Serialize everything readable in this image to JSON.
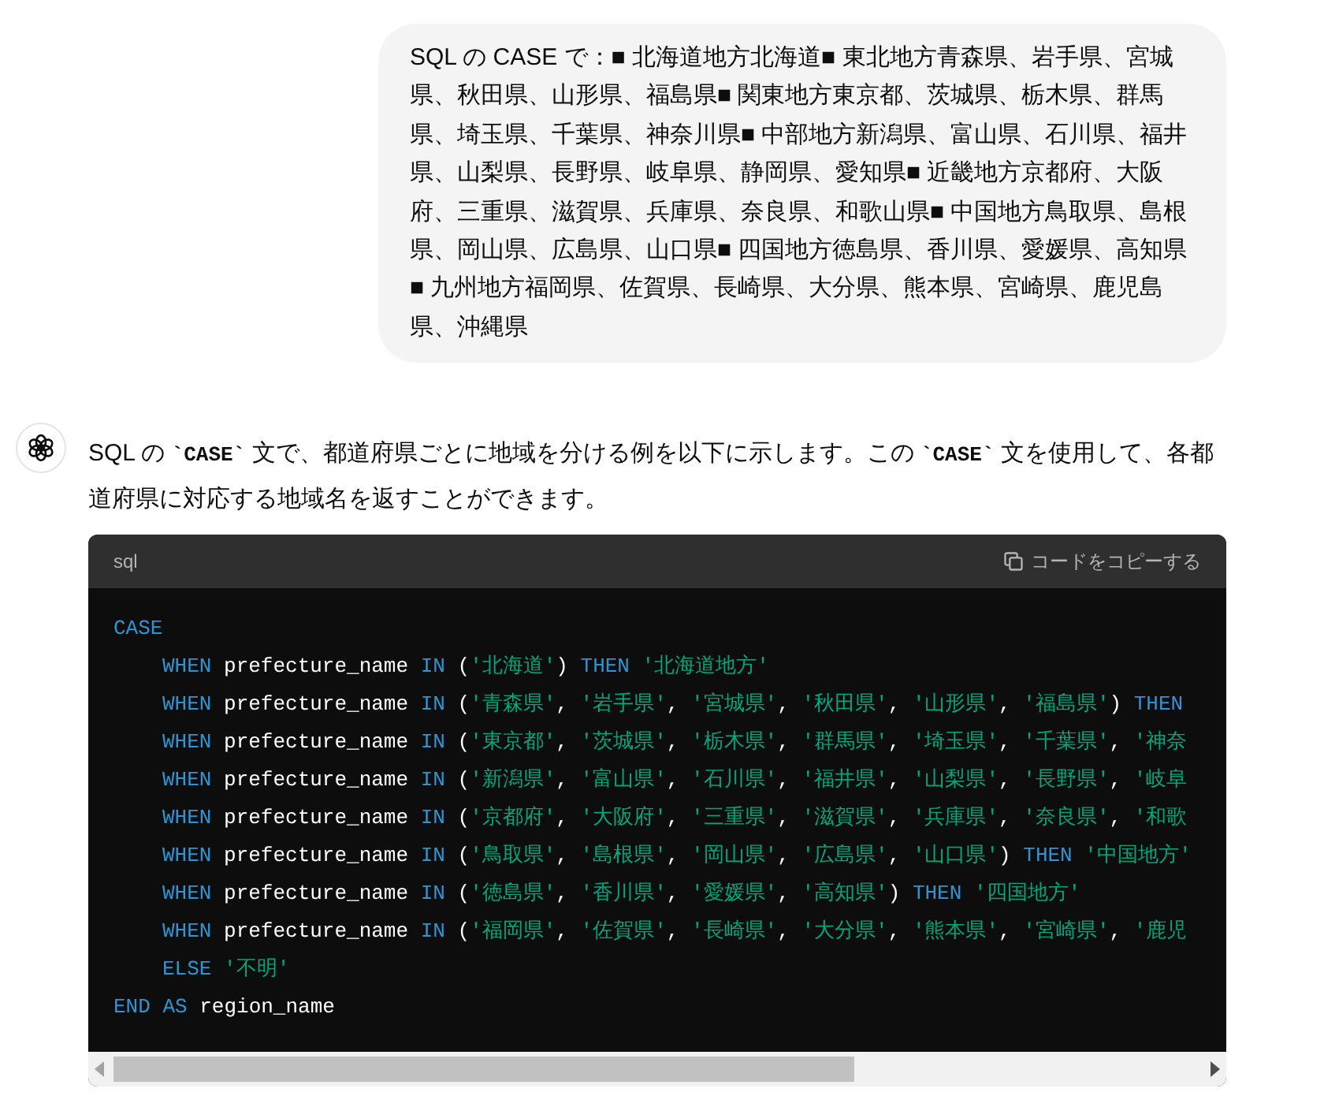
{
  "user_message": {
    "text": "SQL の CASE で：■ 北海道地方北海道■ 東北地方青森県、岩手県、宮城県、秋田県、山形県、福島県■ 関東地方東京都、茨城県、栃木県、群馬県、埼玉県、千葉県、神奈川県■ 中部地方新潟県、富山県、石川県、福井県、山梨県、長野県、岐阜県、静岡県、愛知県■ 近畿地方京都府、大阪府、三重県、滋賀県、兵庫県、奈良県、和歌山県■ 中国地方鳥取県、島根県、岡山県、広島県、山口県■ 四国地方徳島県、香川県、愛媛県、高知県■ 九州地方福岡県、佐賀県、長崎県、大分県、熊本県、宮崎県、鹿児島県、沖縄県"
  },
  "assistant_message": {
    "paragraph": [
      {
        "kind": "text",
        "text": "SQL の "
      },
      {
        "kind": "code",
        "text": "`CASE`"
      },
      {
        "kind": "text",
        "text": " 文で、都道府県ごとに地域を分ける例を以下に示します。この "
      },
      {
        "kind": "code",
        "text": "`CASE`"
      },
      {
        "kind": "text",
        "text": " 文を使用して、各都道府県に対応する地域名を返すことができます。"
      }
    ],
    "code_block": {
      "language": "sql",
      "copy_label": "コードをコピーする",
      "lines": [
        {
          "tokens": [
            {
              "kind": "keyword",
              "text": "CASE"
            }
          ],
          "children": [
            {
              "tokens": [
                {
                  "kind": "keyword",
                  "text": "WHEN"
                },
                {
                  "kind": "plain",
                  "text": " prefecture_name "
                },
                {
                  "kind": "keyword",
                  "text": "IN"
                },
                {
                  "kind": "plain",
                  "text": " ("
                },
                {
                  "kind": "string",
                  "text": "'北海道'"
                },
                {
                  "kind": "plain",
                  "text": ") "
                },
                {
                  "kind": "keyword",
                  "text": "THEN"
                },
                {
                  "kind": "string",
                  "text": " '北海道地方'"
                }
              ]
            },
            {
              "tokens": [
                {
                  "kind": "keyword",
                  "text": "WHEN"
                },
                {
                  "kind": "plain",
                  "text": " prefecture_name "
                },
                {
                  "kind": "keyword",
                  "text": "IN"
                },
                {
                  "kind": "plain",
                  "text": " ("
                },
                {
                  "kind": "string",
                  "text": "'青森県'"
                },
                {
                  "kind": "plain",
                  "text": ", "
                },
                {
                  "kind": "string",
                  "text": "'岩手県'"
                },
                {
                  "kind": "plain",
                  "text": ", "
                },
                {
                  "kind": "string",
                  "text": "'宮城県'"
                },
                {
                  "kind": "plain",
                  "text": ", "
                },
                {
                  "kind": "string",
                  "text": "'秋田県'"
                },
                {
                  "kind": "plain",
                  "text": ", "
                },
                {
                  "kind": "string",
                  "text": "'山形県'"
                },
                {
                  "kind": "plain",
                  "text": ", "
                },
                {
                  "kind": "string",
                  "text": "'福島県'"
                },
                {
                  "kind": "plain",
                  "text": ") "
                },
                {
                  "kind": "keyword",
                  "text": "THEN"
                }
              ]
            },
            {
              "tokens": [
                {
                  "kind": "keyword",
                  "text": "WHEN"
                },
                {
                  "kind": "plain",
                  "text": " prefecture_name "
                },
                {
                  "kind": "keyword",
                  "text": "IN"
                },
                {
                  "kind": "plain",
                  "text": " ("
                },
                {
                  "kind": "string",
                  "text": "'東京都'"
                },
                {
                  "kind": "plain",
                  "text": ", "
                },
                {
                  "kind": "string",
                  "text": "'茨城県'"
                },
                {
                  "kind": "plain",
                  "text": ", "
                },
                {
                  "kind": "string",
                  "text": "'栃木県'"
                },
                {
                  "kind": "plain",
                  "text": ", "
                },
                {
                  "kind": "string",
                  "text": "'群馬県'"
                },
                {
                  "kind": "plain",
                  "text": ", "
                },
                {
                  "kind": "string",
                  "text": "'埼玉県'"
                },
                {
                  "kind": "plain",
                  "text": ", "
                },
                {
                  "kind": "string",
                  "text": "'千葉県'"
                },
                {
                  "kind": "plain",
                  "text": ", "
                },
                {
                  "kind": "string",
                  "text": "'神奈"
                }
              ]
            },
            {
              "tokens": [
                {
                  "kind": "keyword",
                  "text": "WHEN"
                },
                {
                  "kind": "plain",
                  "text": " prefecture_name "
                },
                {
                  "kind": "keyword",
                  "text": "IN"
                },
                {
                  "kind": "plain",
                  "text": " ("
                },
                {
                  "kind": "string",
                  "text": "'新潟県'"
                },
                {
                  "kind": "plain",
                  "text": ", "
                },
                {
                  "kind": "string",
                  "text": "'富山県'"
                },
                {
                  "kind": "plain",
                  "text": ", "
                },
                {
                  "kind": "string",
                  "text": "'石川県'"
                },
                {
                  "kind": "plain",
                  "text": ", "
                },
                {
                  "kind": "string",
                  "text": "'福井県'"
                },
                {
                  "kind": "plain",
                  "text": ", "
                },
                {
                  "kind": "string",
                  "text": "'山梨県'"
                },
                {
                  "kind": "plain",
                  "text": ", "
                },
                {
                  "kind": "string",
                  "text": "'長野県'"
                },
                {
                  "kind": "plain",
                  "text": ", "
                },
                {
                  "kind": "string",
                  "text": "'岐阜"
                }
              ]
            },
            {
              "tokens": [
                {
                  "kind": "keyword",
                  "text": "WHEN"
                },
                {
                  "kind": "plain",
                  "text": " prefecture_name "
                },
                {
                  "kind": "keyword",
                  "text": "IN"
                },
                {
                  "kind": "plain",
                  "text": " ("
                },
                {
                  "kind": "string",
                  "text": "'京都府'"
                },
                {
                  "kind": "plain",
                  "text": ", "
                },
                {
                  "kind": "string",
                  "text": "'大阪府'"
                },
                {
                  "kind": "plain",
                  "text": ", "
                },
                {
                  "kind": "string",
                  "text": "'三重県'"
                },
                {
                  "kind": "plain",
                  "text": ", "
                },
                {
                  "kind": "string",
                  "text": "'滋賀県'"
                },
                {
                  "kind": "plain",
                  "text": ", "
                },
                {
                  "kind": "string",
                  "text": "'兵庫県'"
                },
                {
                  "kind": "plain",
                  "text": ", "
                },
                {
                  "kind": "string",
                  "text": "'奈良県'"
                },
                {
                  "kind": "plain",
                  "text": ", "
                },
                {
                  "kind": "string",
                  "text": "'和歌"
                }
              ]
            },
            {
              "tokens": [
                {
                  "kind": "keyword",
                  "text": "WHEN"
                },
                {
                  "kind": "plain",
                  "text": " prefecture_name "
                },
                {
                  "kind": "keyword",
                  "text": "IN"
                },
                {
                  "kind": "plain",
                  "text": " ("
                },
                {
                  "kind": "string",
                  "text": "'鳥取県'"
                },
                {
                  "kind": "plain",
                  "text": ", "
                },
                {
                  "kind": "string",
                  "text": "'島根県'"
                },
                {
                  "kind": "plain",
                  "text": ", "
                },
                {
                  "kind": "string",
                  "text": "'岡山県'"
                },
                {
                  "kind": "plain",
                  "text": ", "
                },
                {
                  "kind": "string",
                  "text": "'広島県'"
                },
                {
                  "kind": "plain",
                  "text": ", "
                },
                {
                  "kind": "string",
                  "text": "'山口県'"
                },
                {
                  "kind": "plain",
                  "text": ") "
                },
                {
                  "kind": "keyword",
                  "text": "THEN"
                },
                {
                  "kind": "string",
                  "text": " '中国地方'"
                }
              ]
            },
            {
              "tokens": [
                {
                  "kind": "keyword",
                  "text": "WHEN"
                },
                {
                  "kind": "plain",
                  "text": " prefecture_name "
                },
                {
                  "kind": "keyword",
                  "text": "IN"
                },
                {
                  "kind": "plain",
                  "text": " ("
                },
                {
                  "kind": "string",
                  "text": "'徳島県'"
                },
                {
                  "kind": "plain",
                  "text": ", "
                },
                {
                  "kind": "string",
                  "text": "'香川県'"
                },
                {
                  "kind": "plain",
                  "text": ", "
                },
                {
                  "kind": "string",
                  "text": "'愛媛県'"
                },
                {
                  "kind": "plain",
                  "text": ", "
                },
                {
                  "kind": "string",
                  "text": "'高知県'"
                },
                {
                  "kind": "plain",
                  "text": ") "
                },
                {
                  "kind": "keyword",
                  "text": "THEN"
                },
                {
                  "kind": "string",
                  "text": " '四国地方'"
                }
              ]
            },
            {
              "tokens": [
                {
                  "kind": "keyword",
                  "text": "WHEN"
                },
                {
                  "kind": "plain",
                  "text": " prefecture_name "
                },
                {
                  "kind": "keyword",
                  "text": "IN"
                },
                {
                  "kind": "plain",
                  "text": " ("
                },
                {
                  "kind": "string",
                  "text": "'福岡県'"
                },
                {
                  "kind": "plain",
                  "text": ", "
                },
                {
                  "kind": "string",
                  "text": "'佐賀県'"
                },
                {
                  "kind": "plain",
                  "text": ", "
                },
                {
                  "kind": "string",
                  "text": "'長崎県'"
                },
                {
                  "kind": "plain",
                  "text": ", "
                },
                {
                  "kind": "string",
                  "text": "'大分県'"
                },
                {
                  "kind": "plain",
                  "text": ", "
                },
                {
                  "kind": "string",
                  "text": "'熊本県'"
                },
                {
                  "kind": "plain",
                  "text": ", "
                },
                {
                  "kind": "string",
                  "text": "'宮崎県'"
                },
                {
                  "kind": "plain",
                  "text": ", "
                },
                {
                  "kind": "string",
                  "text": "'鹿児"
                }
              ]
            },
            {
              "tokens": [
                {
                  "kind": "keyword",
                  "text": "ELSE"
                },
                {
                  "kind": "string",
                  "text": " '不明'"
                }
              ]
            }
          ]
        },
        {
          "tokens": [
            {
              "kind": "keyword",
              "text": "END"
            },
            {
              "kind": "keyword",
              "text": " AS"
            },
            {
              "kind": "plain",
              "text": " region_name"
            }
          ]
        }
      ]
    }
  }
}
